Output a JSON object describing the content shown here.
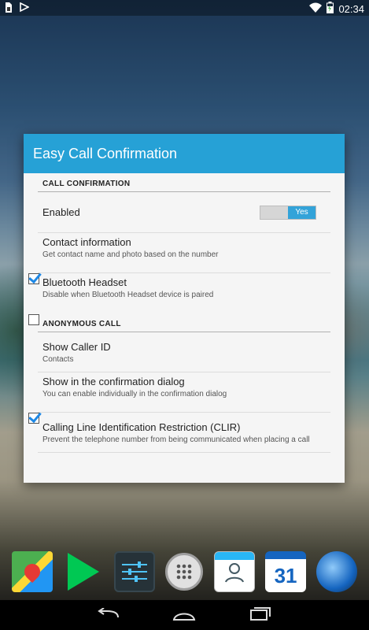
{
  "status_bar": {
    "time": "02:34",
    "icons": [
      "sim-icon",
      "download-icon",
      "wifi-icon",
      "battery-charging-icon"
    ]
  },
  "dialog": {
    "title": "Easy Call Confirmation",
    "sections": [
      {
        "header": "CALL CONFIRMATION",
        "items": [
          {
            "title": "Enabled",
            "widget": "toggle",
            "toggle_on_label": "Yes",
            "value": true
          },
          {
            "title": "Contact information",
            "summary": "Get contact name and photo based on the number",
            "widget": "checkbox",
            "checked": true
          },
          {
            "title": "Bluetooth Headset",
            "summary": "Disable when Bluetooth Headset device is paired",
            "widget": "checkbox",
            "checked": false
          }
        ]
      },
      {
        "header": "ANONYMOUS CALL",
        "items": [
          {
            "title": "Show Caller ID",
            "summary": "Contacts"
          },
          {
            "title": "Show in the confirmation dialog",
            "summary": "You can enable individually in the confirmation dialog",
            "widget": "checkbox",
            "checked": true
          },
          {
            "title": "Calling Line Identification Restriction (CLIR)",
            "summary": "Prevent the telephone number from being communicated when placing a call"
          }
        ]
      }
    ]
  },
  "dock": {
    "apps": [
      "maps-icon",
      "play-store-icon",
      "settings-sliders-icon",
      "app-launcher-icon",
      "contacts-icon",
      "calendar-icon",
      "globe-icon"
    ],
    "calendar_day": "31"
  },
  "nav_bar": {
    "buttons": [
      "back-icon",
      "home-icon",
      "recents-icon"
    ]
  },
  "colors": {
    "accent": "#26a1d6",
    "checkbox": "#1e88e5",
    "dialog_bg": "#f5f5f5"
  }
}
